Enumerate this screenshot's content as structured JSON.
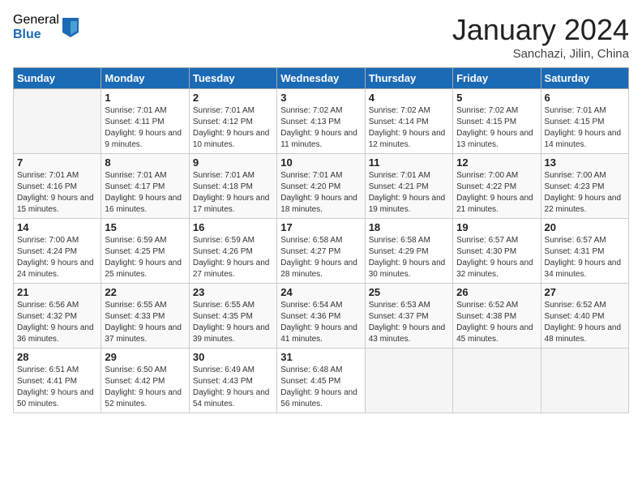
{
  "logo": {
    "general": "General",
    "blue": "Blue"
  },
  "header": {
    "month": "January 2024",
    "location": "Sanchazi, Jilin, China"
  },
  "weekdays": [
    "Sunday",
    "Monday",
    "Tuesday",
    "Wednesday",
    "Thursday",
    "Friday",
    "Saturday"
  ],
  "weeks": [
    [
      {
        "day": null
      },
      {
        "day": 1,
        "sunrise": "7:01 AM",
        "sunset": "4:11 PM",
        "daylight": "9 hours and 9 minutes."
      },
      {
        "day": 2,
        "sunrise": "7:01 AM",
        "sunset": "4:12 PM",
        "daylight": "9 hours and 10 minutes."
      },
      {
        "day": 3,
        "sunrise": "7:02 AM",
        "sunset": "4:13 PM",
        "daylight": "9 hours and 11 minutes."
      },
      {
        "day": 4,
        "sunrise": "7:02 AM",
        "sunset": "4:14 PM",
        "daylight": "9 hours and 12 minutes."
      },
      {
        "day": 5,
        "sunrise": "7:02 AM",
        "sunset": "4:15 PM",
        "daylight": "9 hours and 13 minutes."
      },
      {
        "day": 6,
        "sunrise": "7:01 AM",
        "sunset": "4:15 PM",
        "daylight": "9 hours and 14 minutes."
      }
    ],
    [
      {
        "day": 7,
        "sunrise": "7:01 AM",
        "sunset": "4:16 PM",
        "daylight": "9 hours and 15 minutes."
      },
      {
        "day": 8,
        "sunrise": "7:01 AM",
        "sunset": "4:17 PM",
        "daylight": "9 hours and 16 minutes."
      },
      {
        "day": 9,
        "sunrise": "7:01 AM",
        "sunset": "4:18 PM",
        "daylight": "9 hours and 17 minutes."
      },
      {
        "day": 10,
        "sunrise": "7:01 AM",
        "sunset": "4:20 PM",
        "daylight": "9 hours and 18 minutes."
      },
      {
        "day": 11,
        "sunrise": "7:01 AM",
        "sunset": "4:21 PM",
        "daylight": "9 hours and 19 minutes."
      },
      {
        "day": 12,
        "sunrise": "7:00 AM",
        "sunset": "4:22 PM",
        "daylight": "9 hours and 21 minutes."
      },
      {
        "day": 13,
        "sunrise": "7:00 AM",
        "sunset": "4:23 PM",
        "daylight": "9 hours and 22 minutes."
      }
    ],
    [
      {
        "day": 14,
        "sunrise": "7:00 AM",
        "sunset": "4:24 PM",
        "daylight": "9 hours and 24 minutes."
      },
      {
        "day": 15,
        "sunrise": "6:59 AM",
        "sunset": "4:25 PM",
        "daylight": "9 hours and 25 minutes."
      },
      {
        "day": 16,
        "sunrise": "6:59 AM",
        "sunset": "4:26 PM",
        "daylight": "9 hours and 27 minutes."
      },
      {
        "day": 17,
        "sunrise": "6:58 AM",
        "sunset": "4:27 PM",
        "daylight": "9 hours and 28 minutes."
      },
      {
        "day": 18,
        "sunrise": "6:58 AM",
        "sunset": "4:29 PM",
        "daylight": "9 hours and 30 minutes."
      },
      {
        "day": 19,
        "sunrise": "6:57 AM",
        "sunset": "4:30 PM",
        "daylight": "9 hours and 32 minutes."
      },
      {
        "day": 20,
        "sunrise": "6:57 AM",
        "sunset": "4:31 PM",
        "daylight": "9 hours and 34 minutes."
      }
    ],
    [
      {
        "day": 21,
        "sunrise": "6:56 AM",
        "sunset": "4:32 PM",
        "daylight": "9 hours and 36 minutes."
      },
      {
        "day": 22,
        "sunrise": "6:55 AM",
        "sunset": "4:33 PM",
        "daylight": "9 hours and 37 minutes."
      },
      {
        "day": 23,
        "sunrise": "6:55 AM",
        "sunset": "4:35 PM",
        "daylight": "9 hours and 39 minutes."
      },
      {
        "day": 24,
        "sunrise": "6:54 AM",
        "sunset": "4:36 PM",
        "daylight": "9 hours and 41 minutes."
      },
      {
        "day": 25,
        "sunrise": "6:53 AM",
        "sunset": "4:37 PM",
        "daylight": "9 hours and 43 minutes."
      },
      {
        "day": 26,
        "sunrise": "6:52 AM",
        "sunset": "4:38 PM",
        "daylight": "9 hours and 45 minutes."
      },
      {
        "day": 27,
        "sunrise": "6:52 AM",
        "sunset": "4:40 PM",
        "daylight": "9 hours and 48 minutes."
      }
    ],
    [
      {
        "day": 28,
        "sunrise": "6:51 AM",
        "sunset": "4:41 PM",
        "daylight": "9 hours and 50 minutes."
      },
      {
        "day": 29,
        "sunrise": "6:50 AM",
        "sunset": "4:42 PM",
        "daylight": "9 hours and 52 minutes."
      },
      {
        "day": 30,
        "sunrise": "6:49 AM",
        "sunset": "4:43 PM",
        "daylight": "9 hours and 54 minutes."
      },
      {
        "day": 31,
        "sunrise": "6:48 AM",
        "sunset": "4:45 PM",
        "daylight": "9 hours and 56 minutes."
      },
      {
        "day": null
      },
      {
        "day": null
      },
      {
        "day": null
      }
    ]
  ]
}
